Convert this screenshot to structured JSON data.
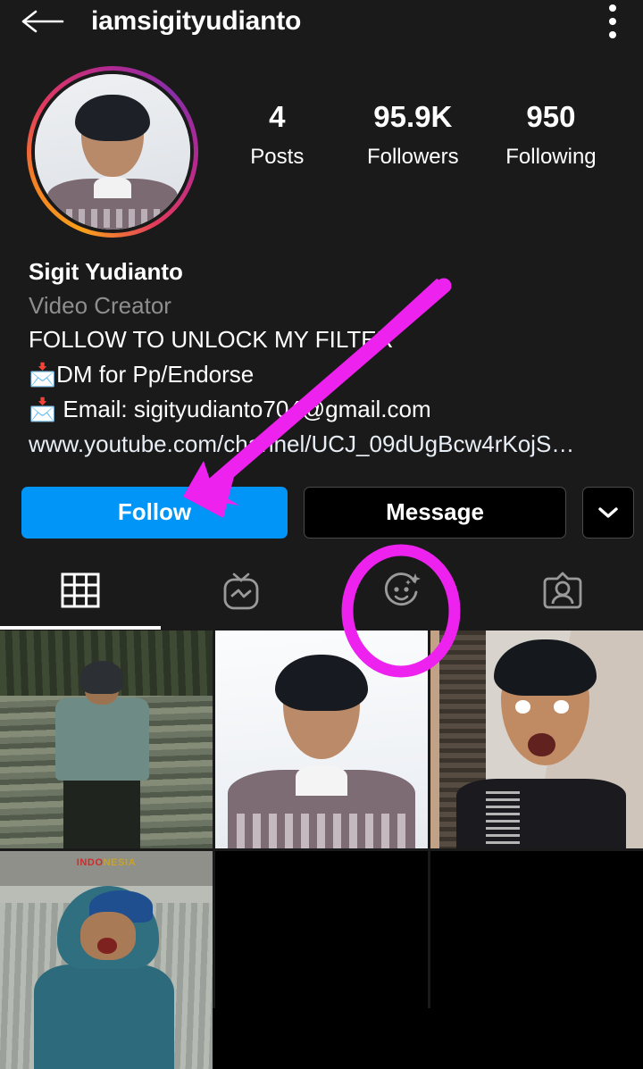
{
  "header": {
    "back_icon": "back-arrow-icon",
    "username": "iamsigityudianto",
    "menu_icon": "overflow-menu-icon"
  },
  "profile": {
    "avatar": "profile-picture-with-story-ring",
    "stats": [
      {
        "value": "4",
        "label": "Posts"
      },
      {
        "value": "95.9K",
        "label": "Followers"
      },
      {
        "value": "950",
        "label": "Following"
      }
    ],
    "full_name": "Sigit Yudianto",
    "category": "Video Creator",
    "bio_lines": [
      {
        "emoji": "",
        "text": "FOLLOW TO UNLOCK MY FILTER"
      },
      {
        "emoji": "📩",
        "text": "DM for Pp/Endorse"
      },
      {
        "emoji": "📩",
        "text": " Email: sigityudianto704@gmail.com"
      }
    ],
    "website": "www.youtube.com/channel/UCJ_09dUgBcw4rKojS…"
  },
  "actions": {
    "follow_label": "Follow",
    "message_label": "Message",
    "chevron_icon": "chevron-down-icon"
  },
  "tabs": [
    {
      "name": "grid",
      "icon": "grid-icon",
      "active": true
    },
    {
      "name": "igtv",
      "icon": "igtv-icon",
      "active": false
    },
    {
      "name": "effects",
      "icon": "effects-face-icon",
      "active": false
    },
    {
      "name": "tagged",
      "icon": "tagged-person-icon",
      "active": false
    }
  ],
  "grid": {
    "posts": [
      {
        "name": "post-1",
        "description": "man in teal shirt against bamboo wall"
      },
      {
        "name": "post-2",
        "description": "studio portrait in patterned shirt on white background"
      },
      {
        "name": "post-3",
        "description": "indoor selfie with surprised expression"
      },
      {
        "name": "post-4",
        "description": "person in blue hoodie near river",
        "watermark_prefix": "INDO",
        "watermark_suffix": "NESIA"
      }
    ]
  },
  "annotations": {
    "arrow_color": "#ee22ee",
    "circle_color": "#ee22ee",
    "arrow_target": "follow-button",
    "circle_target": "effects-tab"
  },
  "colors": {
    "background": "#1a1a1a",
    "follow_blue": "#0095f6",
    "muted_text": "#8e8e8e",
    "magenta": "#ee22ee"
  }
}
